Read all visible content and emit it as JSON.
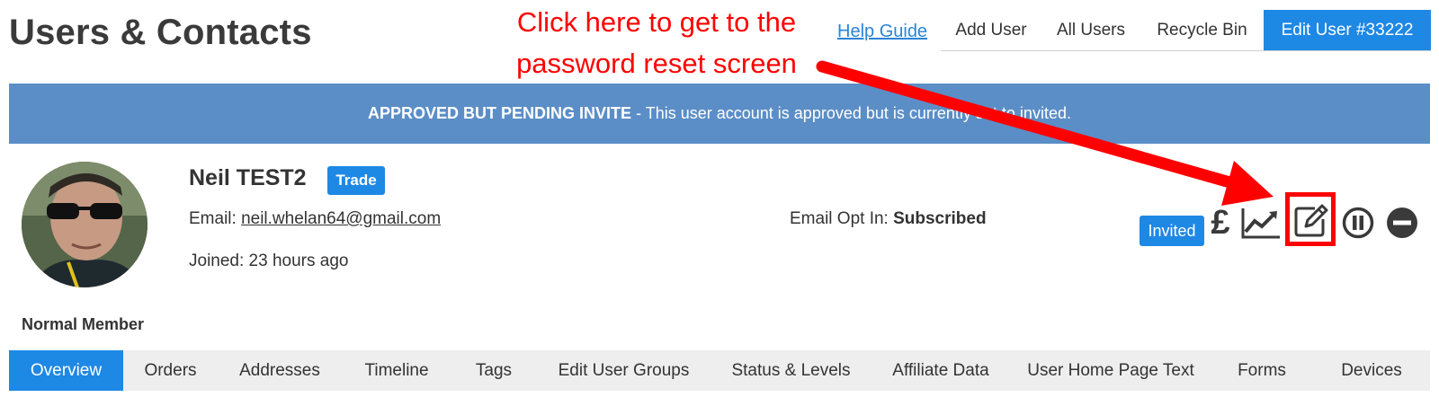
{
  "header": {
    "title": "Users & Contacts",
    "help_link": "Help Guide",
    "tabs": [
      {
        "label": "Add User"
      },
      {
        "label": "All Users"
      },
      {
        "label": "Recycle Bin"
      },
      {
        "label": "Edit User #33222"
      }
    ],
    "active_tab": 3
  },
  "banner": {
    "status": "APPROVED BUT PENDING INVITE",
    "message": "- This user account is approved but is currently set to invited."
  },
  "user": {
    "name": "Neil TEST2",
    "badge": "Trade",
    "email_label": "Email:",
    "email": "neil.whelan64@gmail.com",
    "joined": "Joined: 23 hours ago",
    "optin_label": "Email Opt In:",
    "optin_value": "Subscribed",
    "status_badge": "Invited",
    "member_type": "Normal Member"
  },
  "actions": {
    "icons": [
      "pound-icon",
      "chart-trend-icon",
      "edit-icon",
      "pause-icon",
      "minus-circle-icon"
    ],
    "pound_glyph": "£"
  },
  "tabs": {
    "items": [
      {
        "label": "Overview"
      },
      {
        "label": "Orders"
      },
      {
        "label": "Addresses"
      },
      {
        "label": "Timeline"
      },
      {
        "label": "Tags"
      },
      {
        "label": "Edit User Groups"
      },
      {
        "label": "Status & Levels"
      },
      {
        "label": "Affiliate Data"
      },
      {
        "label": "User Home Page Text"
      },
      {
        "label": "Forms"
      },
      {
        "label": "Devices"
      }
    ],
    "active": 0
  },
  "annotation": {
    "line1": "Click here to get to the",
    "line2": "password reset screen",
    "color": "#ff0000"
  },
  "colors": {
    "accent": "#1e88e5",
    "banner": "#5b8ec7",
    "link": "#2a84d8"
  }
}
